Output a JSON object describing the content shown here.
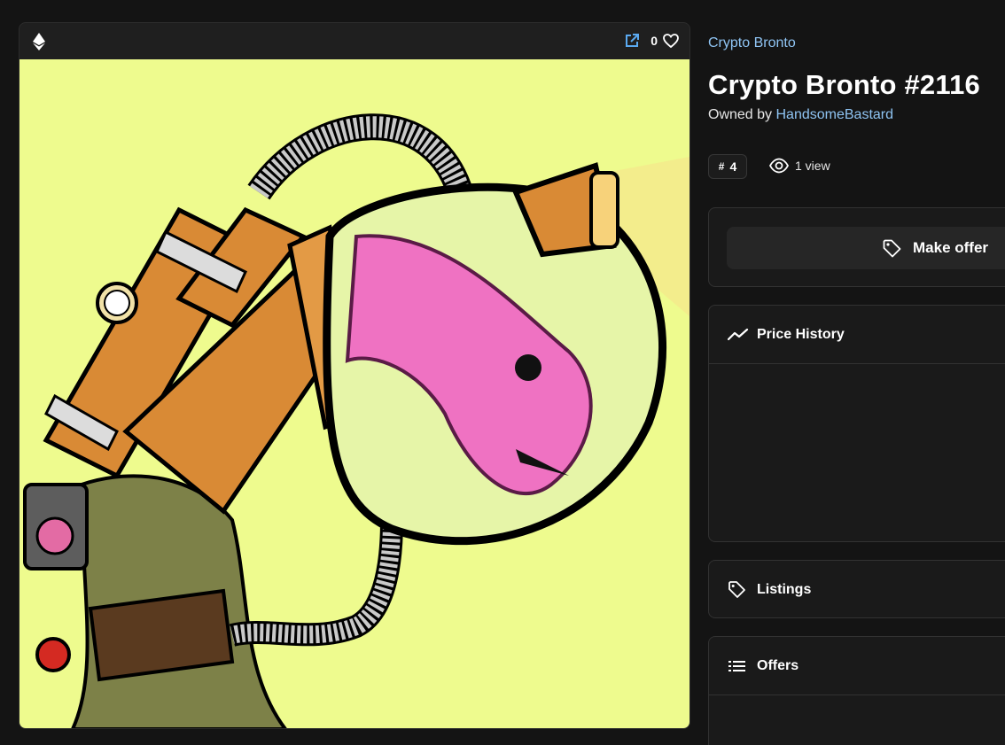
{
  "media": {
    "like_count": "0",
    "icons": {
      "chain": "ethereum-icon",
      "share": "external-link-icon",
      "like": "heart-icon"
    }
  },
  "item": {
    "collection": "Crypto Bronto",
    "title": "Crypto Bronto #2116",
    "owned_by_prefix": "Owned by",
    "owner": "HandsomeBastard",
    "rank_symbol": "#",
    "rank": "4",
    "views": "1 view"
  },
  "actions": {
    "make_offer": "Make offer"
  },
  "sections": {
    "price_history": "Price History",
    "listings": "Listings",
    "offers": "Offers"
  },
  "colors": {
    "background": "#141414",
    "panel": "#1a1a1a",
    "link": "#8fc4f3",
    "artwork_background": "#eefb8e"
  }
}
